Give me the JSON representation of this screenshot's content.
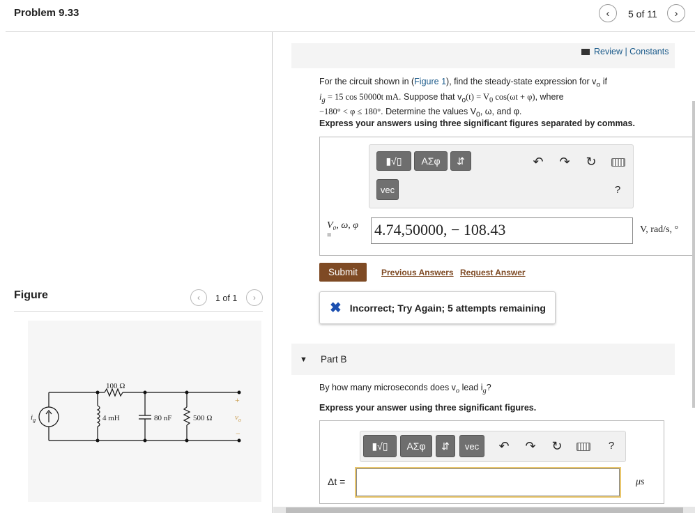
{
  "header": {
    "title": "Problem 9.33",
    "count": "5 of 11",
    "prev_icon": "chevron-left-icon",
    "next_icon": "chevron-right-icon"
  },
  "figure": {
    "label": "Figure",
    "count": "1 of 1",
    "circuit": {
      "source": "i",
      "source_sub": "g",
      "resistor_series": "100 Ω",
      "inductor": "4 mH",
      "capacitor": "80 nF",
      "resistor_load": "500 Ω",
      "plus": "+",
      "minus": "−",
      "output": "v",
      "output_sub": "o"
    }
  },
  "review": {
    "text": "Review | Constants"
  },
  "part_a": {
    "q_line1_pre": "For the circuit shown in (",
    "q_link": "Figure 1",
    "q_line1_post": "), find the steady-state expression for v",
    "q_line1_sub": "o",
    "q_line1_end": " if",
    "q_line2": "i",
    "q_line2_sub": "g",
    "q_line2_eq": " = 15 cos 50000t mA",
    "q_line2_post": ". Suppose that v",
    "q_line2_sub2": "o",
    "q_line2_eq2": "(t) = V",
    "q_line2_sub3": "0",
    "q_line2_eq3": " cos(ωt + φ)",
    "q_line2_end": ", where",
    "q_line3_eq": "−180° < φ ≤ 180°",
    "q_line3_post": ". Determine the values V",
    "q_line3_sub": "0",
    "q_line3_end": ", ω, and φ.",
    "instructions": "Express your answers using three significant figures separated by commas.",
    "vars_label": "V₀, ω, φ",
    "vars_eq": "=",
    "answer_value": "4.74,50000, − 108.43",
    "units": "V, rad/s, °",
    "submit": "Submit",
    "previous_answers": "Previous Answers",
    "request_answer": "Request Answer",
    "feedback": "Incorrect; Try Again; 5 attempts remaining"
  },
  "toolbar": {
    "templates": "▮√▯",
    "greek": "ΑΣφ",
    "arrows": "⇵",
    "vec": "vec",
    "help": "?"
  },
  "part_b": {
    "title": "Part B",
    "question_pre": "By how many microseconds does v",
    "question_sub": "o",
    "question_mid": " lead i",
    "question_sub2": "g",
    "question_end": "?",
    "instructions": "Express your answer using three significant figures.",
    "label": "Δt =",
    "answer_value": "",
    "units": "μs"
  },
  "colors": {
    "brand": "#7e4a24",
    "link": "#1a5a8a",
    "error": "#1b4fb0",
    "focus": "#e9c66b"
  }
}
